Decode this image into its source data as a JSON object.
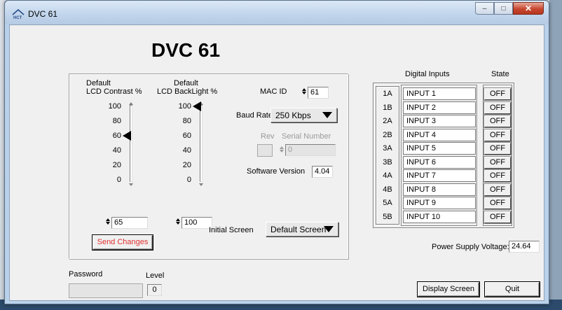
{
  "window": {
    "title": "DVC 61"
  },
  "app": {
    "title": "DVC 61"
  },
  "contrast": {
    "label_line1": "Default",
    "label_line2": "LCD Contrast %",
    "ticks": [
      "100",
      "80",
      "60",
      "40",
      "20",
      "0"
    ],
    "level": 60,
    "value": "65"
  },
  "backlight": {
    "label_line1": "Default",
    "label_line2": "LCD BackLight %",
    "ticks": [
      "100",
      "80",
      "60",
      "40",
      "20",
      "0"
    ],
    "level": 100,
    "value": "100"
  },
  "mac": {
    "label": "MAC ID",
    "value": "61"
  },
  "baud": {
    "label": "Baud Rate",
    "value": "250 Kbps"
  },
  "rev": {
    "label": "Rev",
    "value": ""
  },
  "serial": {
    "label": "Serial Number",
    "value": "0"
  },
  "software": {
    "label": "Software Version",
    "value": "4.04"
  },
  "initial_screen": {
    "label": "Initial Screen",
    "value": "Default Screen"
  },
  "send_changes": {
    "label": "Send Changes"
  },
  "digital_inputs": {
    "header": "Digital Inputs",
    "state_header": "State",
    "rows": [
      {
        "id": "1A",
        "name": "INPUT 1",
        "state": "OFF"
      },
      {
        "id": "1B",
        "name": "INPUT 2",
        "state": "OFF"
      },
      {
        "id": "2A",
        "name": "INPUT 3",
        "state": "OFF"
      },
      {
        "id": "2B",
        "name": "INPUT 4",
        "state": "OFF"
      },
      {
        "id": "3A",
        "name": "INPUT 5",
        "state": "OFF"
      },
      {
        "id": "3B",
        "name": "INPUT 6",
        "state": "OFF"
      },
      {
        "id": "4A",
        "name": "INPUT 7",
        "state": "OFF"
      },
      {
        "id": "4B",
        "name": "INPUT 8",
        "state": "OFF"
      },
      {
        "id": "5A",
        "name": "INPUT 9",
        "state": "OFF"
      },
      {
        "id": "5B",
        "name": "INPUT 10",
        "state": "OFF"
      }
    ]
  },
  "power": {
    "label": "Power Supply Voltage:",
    "value": "24.64"
  },
  "password": {
    "label": "Password",
    "value": ""
  },
  "level": {
    "label": "Level",
    "value": "0"
  },
  "display_screen": {
    "label": "Display Screen"
  },
  "quit": {
    "label": "Quit"
  }
}
